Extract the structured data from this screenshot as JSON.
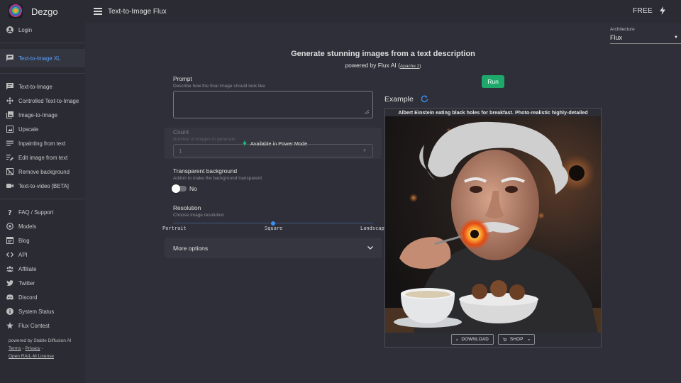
{
  "app": {
    "brand": "Dezgo",
    "title": "Text-to-Image Flux",
    "plan": "FREE"
  },
  "sidebar": {
    "items": [
      {
        "label": "Login",
        "icon": "account-icon"
      },
      {
        "label": "Text-to-Image XL",
        "icon": "chat-icon",
        "active": true
      },
      {
        "label": "Text-to-Image",
        "icon": "chat-icon"
      },
      {
        "label": "Controlled Text-to-Image",
        "icon": "move-icon"
      },
      {
        "label": "Image-to-Image",
        "icon": "images-icon"
      },
      {
        "label": "Upscale",
        "icon": "upscale-icon"
      },
      {
        "label": "Inpainting from text",
        "icon": "inpaint-icon"
      },
      {
        "label": "Edit image from text",
        "icon": "edit-icon"
      },
      {
        "label": "Remove background",
        "icon": "remove-bg-icon"
      },
      {
        "label": "Text-to-video [BETA]",
        "icon": "video-icon"
      },
      {
        "label": "FAQ / Support",
        "icon": "help-icon"
      },
      {
        "label": "Models",
        "icon": "models-icon"
      },
      {
        "label": "Blog",
        "icon": "blog-icon"
      },
      {
        "label": "API",
        "icon": "code-icon"
      },
      {
        "label": "Affiliate",
        "icon": "affiliate-icon"
      },
      {
        "label": "Twitter",
        "icon": "twitter-icon"
      },
      {
        "label": "Discord",
        "icon": "discord-icon"
      },
      {
        "label": "System Status",
        "icon": "info-icon"
      },
      {
        "label": "Flux Contest",
        "icon": "star-icon"
      }
    ],
    "footer": {
      "powered": "powered by Stable Diffusion AI",
      "terms": "Terms",
      "dash": " - ",
      "privacy": "Privacy",
      "dash2": " - ",
      "license": "Open RAIL-M License"
    }
  },
  "architecture": {
    "label": "Architecture",
    "value": "Flux"
  },
  "header": {
    "title": "Generate stunning images from a text description",
    "powered_by": "powered by Flux AI (",
    "license_link": "Apache 2",
    "close_paren": ")"
  },
  "form": {
    "prompt_label": "Prompt",
    "prompt_hint": "Describe how the final image should look like",
    "prompt_value": "",
    "run_label": "Run",
    "count_label": "Count",
    "count_hint": "Number of images to generate",
    "count_value": "1",
    "power_mode": "Available in Power Mode",
    "transparent_label": "Transparent background",
    "transparent_hint": "Addon to make the background transparent",
    "transparent_value": "No",
    "resolution_label": "Resolution",
    "resolution_hint": "Choose image resolution",
    "resolution_options": [
      "Portrait",
      "Square",
      "Landscape"
    ],
    "resolution_selected": "Square",
    "more_options": "More options"
  },
  "example": {
    "title": "Example",
    "caption": "Albert Einstein eating black holes for breakfast. Photo-realistic highly-detailed",
    "download": "DOWNLOAD",
    "shop": "SHOP"
  },
  "colors": {
    "accent": "#1fa86b",
    "link_active": "#5aa2ff",
    "slider": "#3d8ff0"
  }
}
